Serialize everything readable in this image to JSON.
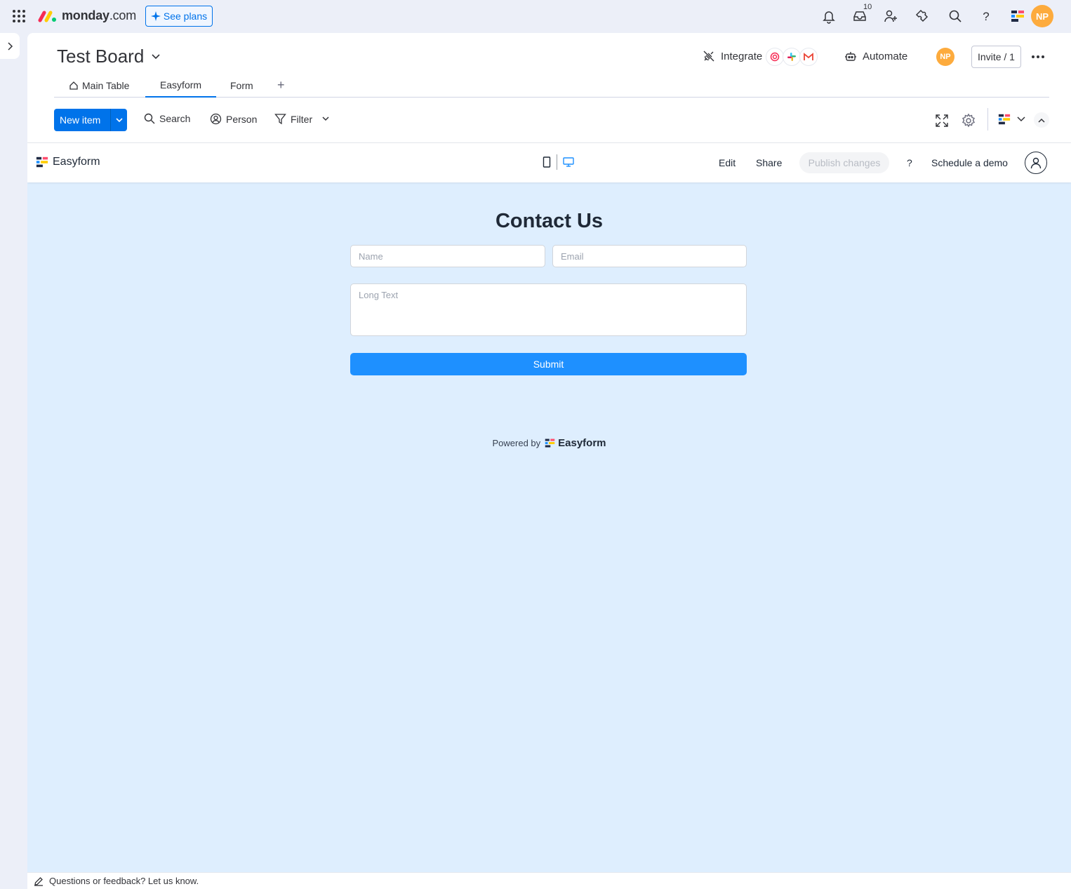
{
  "topbar": {
    "logo_main": "monday",
    "logo_suffix": ".com",
    "see_plans": "See plans",
    "inbox_badge": "10",
    "avatar_initials": "NP"
  },
  "board": {
    "title": "Test Board",
    "integrate_label": "Integrate",
    "automate_label": "Automate",
    "avatar_initials": "NP",
    "invite_label": "Invite / 1",
    "tabs": [
      {
        "label": "Main Table"
      },
      {
        "label": "Easyform"
      },
      {
        "label": "Form"
      }
    ],
    "tab_add": "+",
    "toolbar": {
      "new_item": "New item",
      "search": "Search",
      "person": "Person",
      "filter": "Filter"
    }
  },
  "easyform": {
    "brand": "Easyform",
    "edit": "Edit",
    "share": "Share",
    "publish": "Publish changes",
    "help": "?",
    "schedule": "Schedule a demo"
  },
  "form": {
    "title": "Contact Us",
    "name_placeholder": "Name",
    "email_placeholder": "Email",
    "long_text_placeholder": "Long Text",
    "submit": "Submit",
    "powered_by": "Powered by",
    "powered_brand": "Easyform"
  },
  "feedback": {
    "text": "Questions or feedback? Let us know."
  },
  "colors": {
    "primary": "#0073ea",
    "avatar": "#fdab3d",
    "form_bg": "#deeefe",
    "submit": "#1e90ff"
  }
}
